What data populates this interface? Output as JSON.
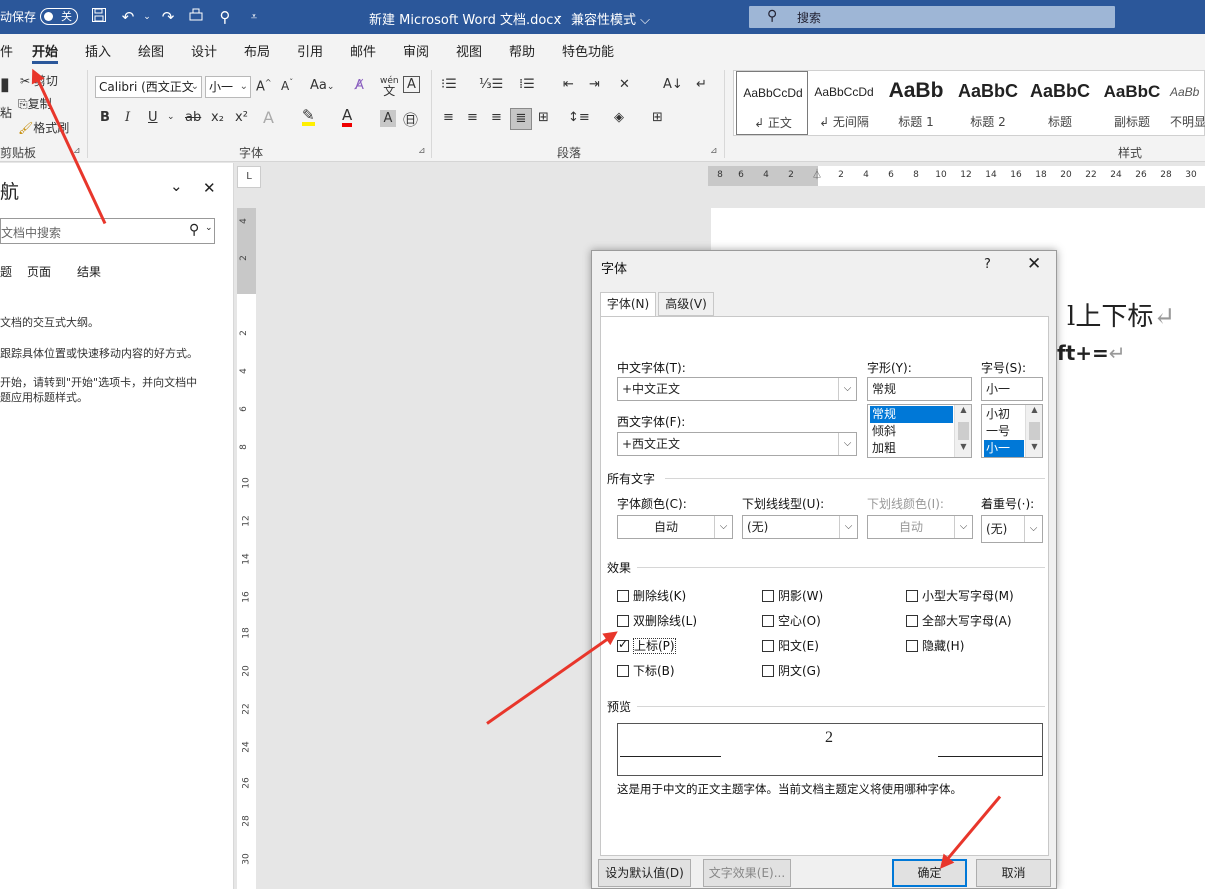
{
  "titlebar": {
    "autosave_label": "动保存",
    "autosave_state": "关",
    "doc_title": "新建 Microsoft Word 文档.docx",
    "separator": "-",
    "mode": "兼容性模式 ⌵",
    "search_placeholder": "搜索",
    "bg_color": "#2b579a"
  },
  "menu": {
    "tabs": [
      "件",
      "开始",
      "插入",
      "绘图",
      "设计",
      "布局",
      "引用",
      "邮件",
      "审阅",
      "视图",
      "帮助",
      "特色功能"
    ]
  },
  "ribbon": {
    "clipboard": {
      "cut": "剪切",
      "copy": "复制",
      "format_painter": "格式刷",
      "paste_partial": "粘",
      "label": "剪贴板"
    },
    "font": {
      "font_name": "Calibri (西文正文",
      "font_size": "小一",
      "bold": "B",
      "italic": "I",
      "underline": "U",
      "strike": "ab",
      "sub": "x₂",
      "sup": "x²",
      "case": "Aa",
      "wen": "wén",
      "label": "字体"
    },
    "paragraph": {
      "label": "段落"
    },
    "styles": {
      "label": "样式",
      "items": [
        {
          "preview": "AaBbCcDd",
          "name": "↲ 正文"
        },
        {
          "preview": "AaBbCcDd",
          "name": "↲ 无间隔"
        },
        {
          "preview": "AaBb",
          "name": "标题 1"
        },
        {
          "preview": "AaBbC",
          "name": "标题 2"
        },
        {
          "preview": "AaBbC",
          "name": "标题"
        },
        {
          "preview": "AaBbC",
          "name": "副标题"
        },
        {
          "preview": "AaBb",
          "name": "不明显"
        }
      ]
    }
  },
  "nav": {
    "title": "航",
    "search_placeholder": "文档中搜索",
    "tabs": [
      "题",
      "页面",
      "结果"
    ],
    "text1": "文档的交互式大纲。",
    "text2": "跟踪具体位置或快速移动内容的好方式。",
    "text3": "开始，请转到\"开始\"选项卡，并向文档中",
    "text4": "题应用标题样式。"
  },
  "ruler": {
    "corner": "L",
    "h_numbers": [
      "8",
      "6",
      "4",
      "2",
      "2",
      "4",
      "6",
      "8",
      "10",
      "12",
      "14",
      "16",
      "18",
      "20",
      "22",
      "24",
      "26",
      "28",
      "30"
    ],
    "v_numbers": [
      "4",
      "2",
      "2",
      "4",
      "6",
      "8",
      "10",
      "12",
      "14",
      "16",
      "18",
      "20",
      "22",
      "24",
      "26",
      "28",
      "30"
    ]
  },
  "document": {
    "line1": "l上下标",
    "line2": "ft+=",
    "para_mark": "↵"
  },
  "dialog": {
    "title": "字体",
    "help": "?",
    "close": "✕",
    "tab_font": "字体(N)",
    "tab_advanced": "高级(V)",
    "cn_font_label": "中文字体(T):",
    "cn_font_value": "+中文正文",
    "west_font_label": "西文字体(F):",
    "west_font_value": "+西文正文",
    "style_label": "字形(Y):",
    "style_value": "常规",
    "style_options": [
      "常规",
      "倾斜",
      "加粗"
    ],
    "size_label": "字号(S):",
    "size_value": "小一",
    "size_options": [
      "小初",
      "一号",
      "小一"
    ],
    "all_text_section": "所有文字",
    "font_color_label": "字体颜色(C):",
    "font_color_value": "自动",
    "underline_type_label": "下划线线型(U):",
    "underline_type_value": "(无)",
    "underline_color_label": "下划线颜色(I):",
    "underline_color_value": "自动",
    "emphasis_label": "着重号(·):",
    "emphasis_value": "(无)",
    "effects_section": "效果",
    "effects": [
      {
        "label": "删除线(K)",
        "checked": false
      },
      {
        "label": "阴影(W)",
        "checked": false
      },
      {
        "label": "小型大写字母(M)",
        "checked": false
      },
      {
        "label": "双删除线(L)",
        "checked": false
      },
      {
        "label": "空心(O)",
        "checked": false
      },
      {
        "label": "全部大写字母(A)",
        "checked": false
      },
      {
        "label": "上标(P)",
        "checked": true
      },
      {
        "label": "阳文(E)",
        "checked": false
      },
      {
        "label": "隐藏(H)",
        "checked": false
      },
      {
        "label": "下标(B)",
        "checked": false
      },
      {
        "label": "阴文(G)",
        "checked": false
      }
    ],
    "preview_section": "预览",
    "preview_text": "2",
    "preview_desc": "这是用于中文的正文主题字体。当前文档主题定义将使用哪种字体。",
    "btn_default": "设为默认值(D)",
    "btn_text_effects": "文字效果(E)...",
    "btn_ok": "确定",
    "btn_cancel": "取消"
  },
  "annotation_color": "#e8362b"
}
